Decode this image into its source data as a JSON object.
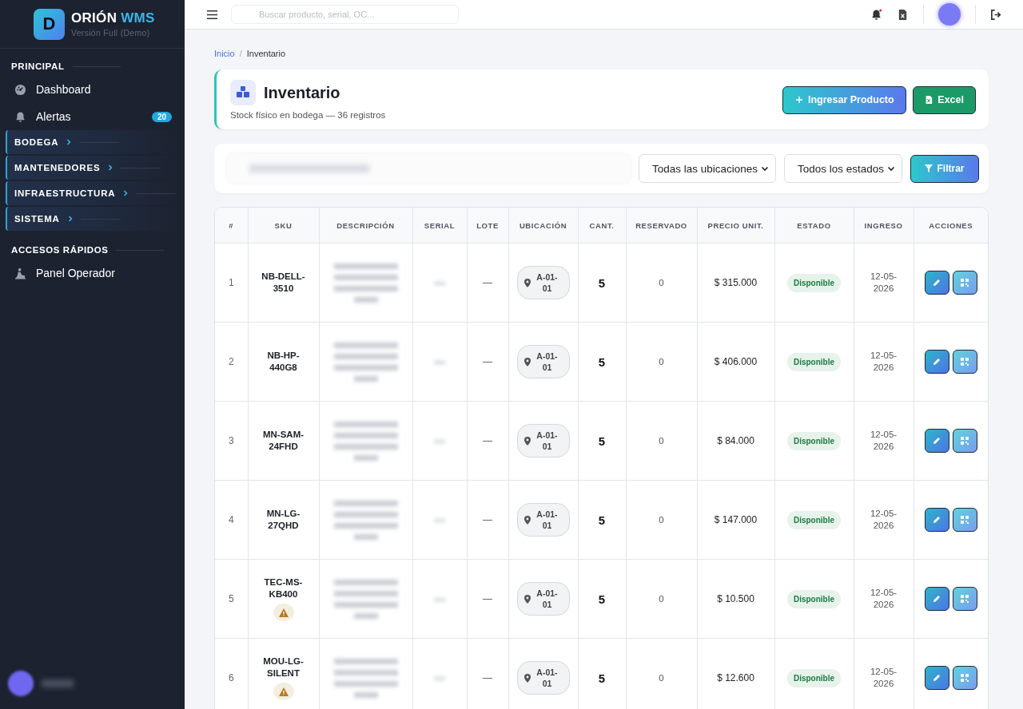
{
  "sidebar": {
    "brand_name": "ORIÓN",
    "brand_suffix": "WMS",
    "logo_letter": "D",
    "subtitle": "Versión Full (Demo)",
    "sections": [
      {
        "title": "PRINCIPAL",
        "items": [
          {
            "label": "Dashboard",
            "kind": "gauge"
          },
          {
            "label": "Alertas",
            "kind": "bell",
            "badge": "20"
          }
        ]
      },
      {
        "groups": [
          {
            "label": "BODEGA",
            "expanded": false
          },
          {
            "label": "MANTENEDORES",
            "expanded": false
          },
          {
            "label": "INFRAESTRUCTURA",
            "expanded": false
          },
          {
            "label": "SISTEMA",
            "expanded": false
          }
        ]
      },
      {
        "title": "ACCESOS RÁPIDOS",
        "items": [
          {
            "label": "Panel Operador",
            "kind": "worker"
          }
        ]
      }
    ]
  },
  "topbar": {
    "search": {
      "placeholder": "Buscar producto, serial, OC..."
    },
    "notification_dot": true
  },
  "breadcrumb": {
    "separator": "/",
    "items": [
      {
        "label": "Inicio",
        "link": true
      },
      {
        "label": "Inventario",
        "link": false
      }
    ]
  },
  "header": {
    "title": "Inventario",
    "subtitle": "Stock físico en bodega — 36 registros",
    "buttons": [
      {
        "label": "Ingresar Producto",
        "kind": "primary"
      },
      {
        "label": "Excel",
        "kind": "excel"
      }
    ]
  },
  "filters": {
    "location": "Todas las ubicaciones",
    "status": "Todos los estados",
    "button": "Filtrar"
  },
  "table": {
    "columns": [
      "#",
      "SKU",
      "DESCRIPCIÓN",
      "SERIAL",
      "LOTE",
      "UBICACIÓN",
      "CANT.",
      "RESERVADO",
      "PRECIO UNIT.",
      "ESTADO",
      "INGRESO",
      "ACCIONES"
    ],
    "rows": [
      {
        "n": "1",
        "sku": "NB-DELL-3510",
        "warning": false,
        "lote": "—",
        "location": "A-01-01",
        "qty": "5",
        "reserved": "0",
        "price": "$ 315.000",
        "status": "Disponible",
        "date": "12-05-2026"
      },
      {
        "n": "2",
        "sku": "NB-HP-440G8",
        "warning": false,
        "lote": "—",
        "location": "A-01-01",
        "qty": "5",
        "reserved": "0",
        "price": "$ 406.000",
        "status": "Disponible",
        "date": "12-05-2026"
      },
      {
        "n": "3",
        "sku": "MN-SAM-24FHD",
        "warning": false,
        "lote": "—",
        "location": "A-01-01",
        "qty": "5",
        "reserved": "0",
        "price": "$ 84.000",
        "status": "Disponible",
        "date": "12-05-2026"
      },
      {
        "n": "4",
        "sku": "MN-LG-27QHD",
        "warning": false,
        "lote": "—",
        "location": "A-01-01",
        "qty": "5",
        "reserved": "0",
        "price": "$ 147.000",
        "status": "Disponible",
        "date": "12-05-2026"
      },
      {
        "n": "5",
        "sku": "TEC-MS-KB400",
        "warning": true,
        "lote": "—",
        "location": "A-01-01",
        "qty": "5",
        "reserved": "0",
        "price": "$ 10.500",
        "status": "Disponible",
        "date": "12-05-2026"
      },
      {
        "n": "6",
        "sku": "MOU-LG-SILENT",
        "warning": true,
        "lote": "—",
        "location": "A-01-01",
        "qty": "5",
        "reserved": "0",
        "price": "$ 12.600",
        "status": "Disponible",
        "date": "12-05-2026"
      }
    ]
  }
}
